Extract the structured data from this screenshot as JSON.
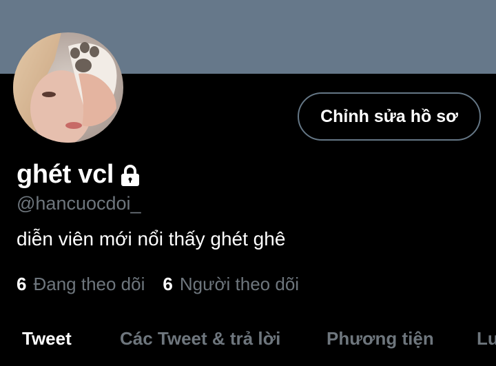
{
  "profile": {
    "display_name": "ghét vcl",
    "handle": "@hancuocdoi_",
    "bio": "diễn viên mới nổi thấy ghét ghê",
    "edit_button_label": "Chỉnh sửa hồ sơ",
    "locked_icon": "lock-icon"
  },
  "stats": {
    "following_count": "6",
    "following_label": "Đang theo dõi",
    "followers_count": "6",
    "followers_label": "Người theo dõi"
  },
  "tabs": [
    {
      "label": "Tweet",
      "active": true
    },
    {
      "label": "Các Tweet & trả lời",
      "active": false
    },
    {
      "label": "Phương tiện",
      "active": false
    },
    {
      "label": "Lu",
      "active": false
    }
  ],
  "colors": {
    "background": "#000000",
    "banner": "#66788a",
    "secondary_text": "#6e767d",
    "button_border": "#657786"
  }
}
